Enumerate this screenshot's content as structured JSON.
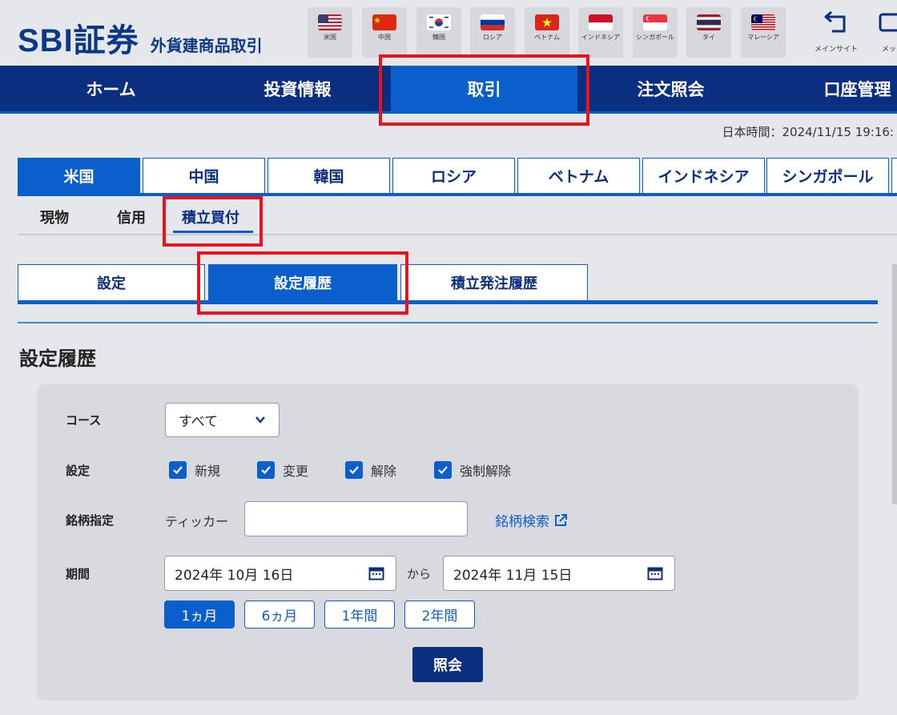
{
  "header": {
    "logo_main": "SBI証券",
    "logo_sub": "外貨建商品取引",
    "flags": [
      {
        "label": "米国",
        "icon": "us-flag-icon"
      },
      {
        "label": "中国",
        "icon": "china-flag-icon"
      },
      {
        "label": "韓国",
        "icon": "korea-flag-icon"
      },
      {
        "label": "ロシア",
        "icon": "russia-flag-icon"
      },
      {
        "label": "ベトナム",
        "icon": "vietnam-flag-icon"
      },
      {
        "label": "インドネシア",
        "icon": "indonesia-flag-icon"
      },
      {
        "label": "シンガポール",
        "icon": "singapore-flag-icon"
      },
      {
        "label": "タイ",
        "icon": "thailand-flag-icon"
      },
      {
        "label": "マレーシア",
        "icon": "malaysia-flag-icon"
      }
    ],
    "main_site_label": "メインサイト",
    "message_label": "メッ"
  },
  "global_nav": [
    "ホーム",
    "投資情報",
    "取引",
    "注文照会",
    "口座管理"
  ],
  "datetime": "日本時間：2024/11/15 19:16:",
  "country_tabs": [
    "米国",
    "中国",
    "韓国",
    "ロシア",
    "ベトナム",
    "インドネシア",
    "シンガポール"
  ],
  "sub_tabs": [
    "現物",
    "信用",
    "積立買付"
  ],
  "page_tabs": [
    "設定",
    "設定履歴",
    "積立発注履歴"
  ],
  "page_title": "設定履歴",
  "form": {
    "course_label": "コース",
    "course_value": "すべて",
    "setting_label": "設定",
    "checkboxes": [
      "新規",
      "変更",
      "解除",
      "強制解除"
    ],
    "stock_label": "銘柄指定",
    "ticker_label": "ティッカー",
    "ticker_value": "",
    "stock_search": "銘柄検索",
    "period_label": "期間",
    "date_from": "2024年 10月 16日",
    "date_sep": "から",
    "date_to": "2024年 11月 15日",
    "period_buttons": [
      "1ヵ月",
      "6ヵ月",
      "1年間",
      "2年間"
    ],
    "submit": "照会"
  },
  "colors": {
    "navy": "#0b2f80",
    "accent_blue": "#0b5fcc",
    "highlight_red": "#e8131d"
  }
}
